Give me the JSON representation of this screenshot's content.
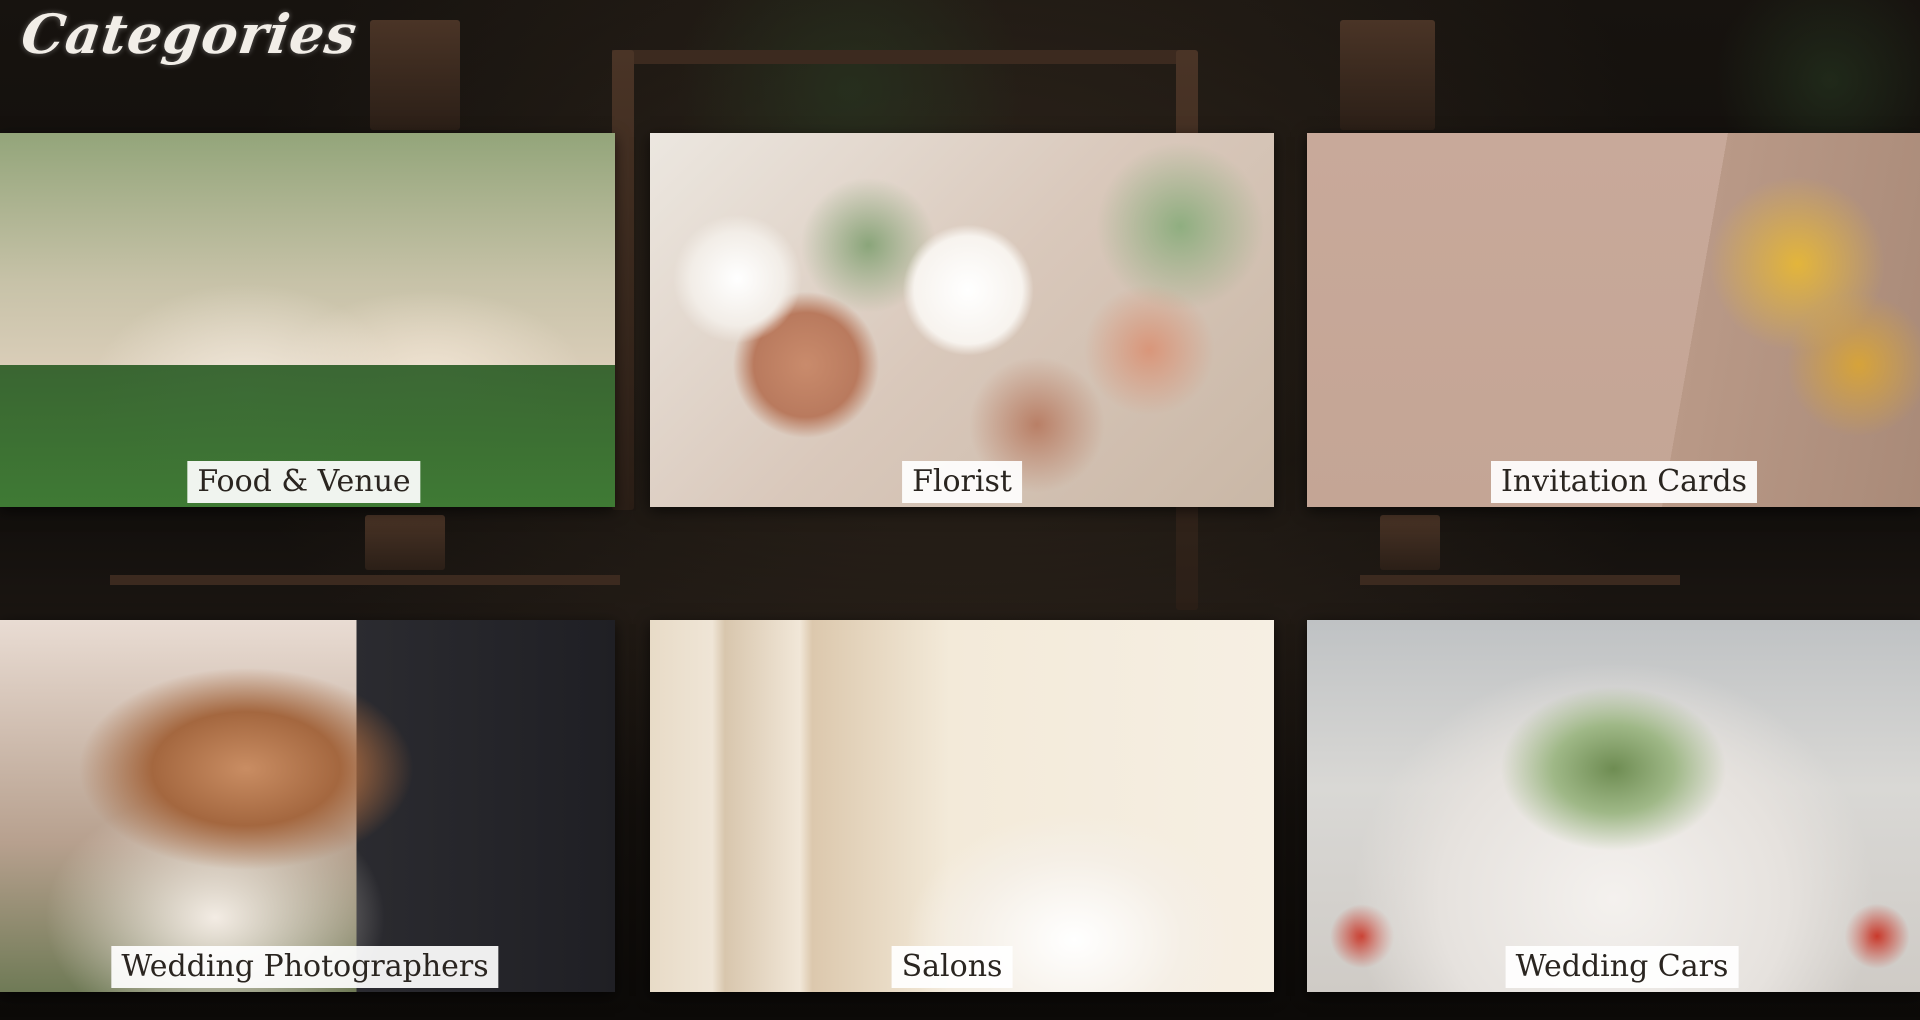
{
  "page": {
    "title": "Categories"
  },
  "categories": [
    {
      "label": "Food & Venue"
    },
    {
      "label": "Florist"
    },
    {
      "label": "Invitation Cards"
    },
    {
      "label": "Wedding Photographers"
    },
    {
      "label": "Salons"
    },
    {
      "label": "Wedding Cars"
    }
  ]
}
